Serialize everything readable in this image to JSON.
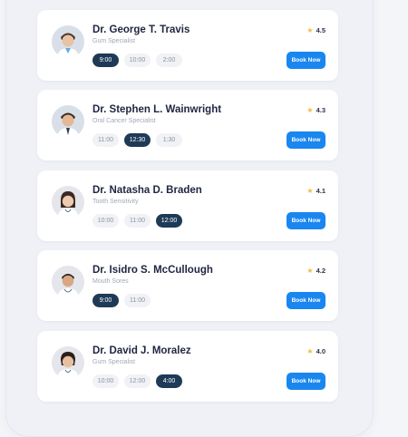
{
  "doctors": [
    {
      "name": "Dr. George T. Travis",
      "specialty": "Gum Specialist",
      "rating": "4.5",
      "slots": [
        "9:00",
        "10:00",
        "2:00"
      ],
      "selected_slot": 0,
      "book_label": "Book Now",
      "avatar_icon": "doctor-avatar-icon"
    },
    {
      "name": "Dr. Stephen L. Wainwright",
      "specialty": "Oral Cancer Specialist",
      "rating": "4.3",
      "slots": [
        "11:00",
        "12:30",
        "1:30"
      ],
      "selected_slot": 1,
      "book_label": "Book Now",
      "avatar_icon": "doctor-avatar-icon"
    },
    {
      "name": "Dr. Natasha D. Braden",
      "specialty": "Tooth Sensitivity",
      "rating": "4.1",
      "slots": [
        "10:00",
        "11:00",
        "12:00"
      ],
      "selected_slot": 2,
      "book_label": "Book Now",
      "avatar_icon": "doctor-avatar-icon"
    },
    {
      "name": "Dr. Isidro S. McCullough",
      "specialty": "Mouth Sores",
      "rating": "4.2",
      "slots": [
        "9:00",
        "11:00"
      ],
      "selected_slot": 0,
      "book_label": "Book Now",
      "avatar_icon": "doctor-avatar-icon"
    },
    {
      "name": "Dr. David J. Moralez",
      "specialty": "Gum Specialist",
      "rating": "4.0",
      "slots": [
        "10:00",
        "12:00",
        "4:00"
      ],
      "selected_slot": 2,
      "book_label": "Book Now",
      "avatar_icon": "doctor-avatar-icon"
    }
  ],
  "colors": {
    "accent": "#1a86f0",
    "selected_slot": "#1e3a57",
    "star": "#f6b93b",
    "background": "#eff1f7"
  }
}
